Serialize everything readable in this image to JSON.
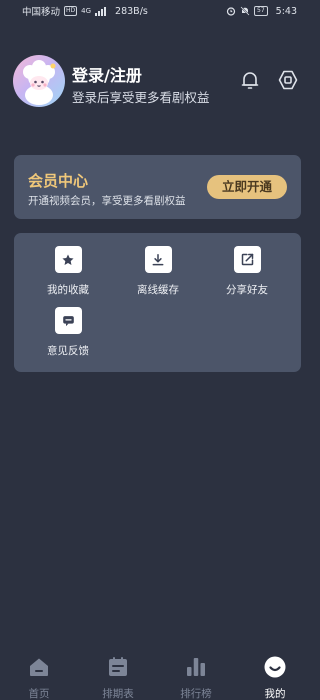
{
  "status_bar": {
    "carrier": "中国移动",
    "carrier_badge": "HD",
    "network": "4G",
    "speed": "283B/s",
    "battery": "57",
    "time": "5:43"
  },
  "profile": {
    "title": "登录/注册",
    "subtitle": "登录后享受更多看剧权益"
  },
  "vip": {
    "title": "会员中心",
    "subtitle": "开通视频会员，享受更多看剧权益",
    "button": "立即开通"
  },
  "features": [
    {
      "label": "我的收藏",
      "icon": "star-icon"
    },
    {
      "label": "离线缓存",
      "icon": "download-icon"
    },
    {
      "label": "分享好友",
      "icon": "share-icon"
    },
    {
      "label": "意见反馈",
      "icon": "feedback-icon"
    }
  ],
  "nav": [
    {
      "label": "首页",
      "icon": "home-icon"
    },
    {
      "label": "排期表",
      "icon": "schedule-icon"
    },
    {
      "label": "排行榜",
      "icon": "ranking-icon"
    },
    {
      "label": "我的",
      "icon": "profile-icon"
    }
  ],
  "colors": {
    "background": "#2c3140",
    "card": "#4c5569",
    "vip_gold": "#f0c87a",
    "vip_button": "#e6c27e"
  }
}
